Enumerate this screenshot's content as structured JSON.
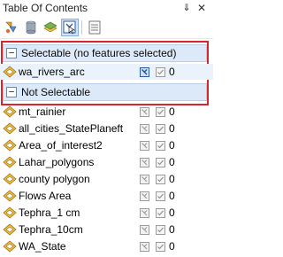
{
  "window": {
    "title": "Table Of Contents",
    "pin_glyph": "⇓",
    "close_glyph": "✕"
  },
  "toolbar": {
    "buttons": [
      {
        "name": "list-by-drawing-order-icon"
      },
      {
        "name": "list-by-source-icon"
      },
      {
        "name": "list-by-visibility-icon"
      },
      {
        "name": "list-by-selection-icon",
        "active": true
      },
      {
        "name": "options-icon"
      }
    ]
  },
  "groups": {
    "selectable": {
      "toggle": "−",
      "label": "Selectable (no features selected)"
    },
    "not_selectable": {
      "toggle": "−",
      "label": "Not Selectable"
    }
  },
  "selectable_layers": [
    {
      "name": "wa_rivers_arc",
      "count": "0"
    }
  ],
  "not_selectable_layers": [
    {
      "name": "mt_rainier",
      "count": "0"
    },
    {
      "name": "all_cities_StatePlaneft",
      "count": "0"
    },
    {
      "name": "Area_of_interest2",
      "count": "0"
    },
    {
      "name": "Lahar_polygons",
      "count": "0"
    },
    {
      "name": "county polygon",
      "count": "0"
    },
    {
      "name": "Flows Area",
      "count": "0"
    },
    {
      "name": "Tephra_1 cm",
      "count": "0"
    },
    {
      "name": "Tephra_10cm",
      "count": "0"
    },
    {
      "name": "WA_State",
      "count": "0"
    }
  ],
  "colors": {
    "highlight_border": "#d7262e",
    "group_bg": "#dce9f9",
    "layer_icon": "#d99a1e"
  }
}
